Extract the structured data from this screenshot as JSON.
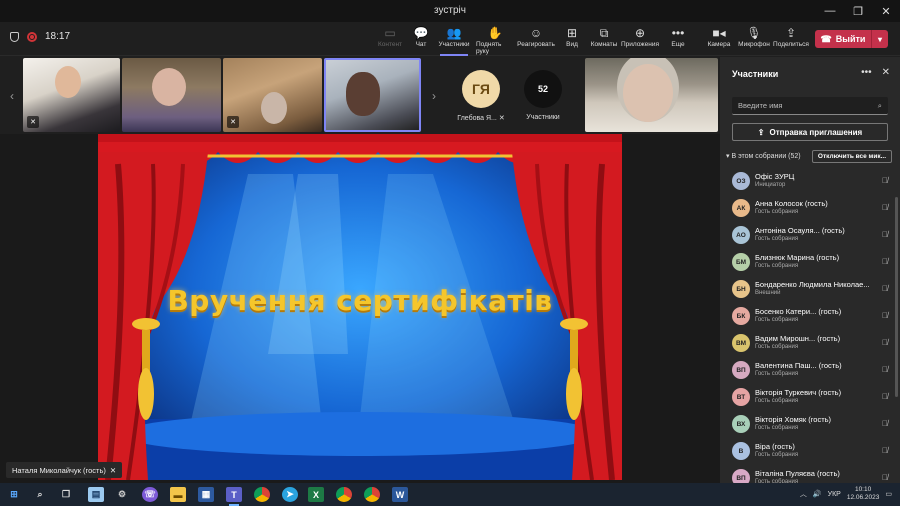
{
  "window": {
    "title": "зустріч"
  },
  "toolbar": {
    "timer": "18:17",
    "buttons": {
      "content": "Контент",
      "chat": "Чат",
      "participants": "Участники",
      "raise_hand": "Поднять руку",
      "react": "Реагировать",
      "view": "Вид",
      "rooms": "Комнаты",
      "apps": "Приложения",
      "more": "Еще",
      "camera": "Камера",
      "mic": "Микрофон",
      "share": "Поделиться"
    },
    "leave_label": "Выйти"
  },
  "strip": {
    "avatar_tile": {
      "initials": "ГЯ",
      "label": "Глебова Я..."
    },
    "count_tile": {
      "count": "52",
      "label": "Участники"
    }
  },
  "stage": {
    "slide_title": "Вручення сертифікатів",
    "presenter": "Наталя Миколайчук (гость)"
  },
  "panel": {
    "title": "Участники",
    "search_placeholder": "Введите имя",
    "invite_label": "Отправка приглашения",
    "section_label": "В этом собрании (52)",
    "mute_all_label": "Отключить все мик...",
    "participants": [
      {
        "initials": "ОЗ",
        "name": "Офіс ЗУРЦ",
        "role": "Инициатор",
        "color": "#a9b9d6"
      },
      {
        "initials": "АК",
        "name": "Анна Колосок (гость)",
        "role": "Гость собрания",
        "color": "#e8b98a"
      },
      {
        "initials": "АО",
        "name": "Антоніна Осауля... (гость)",
        "role": "Гость собрания",
        "color": "#a9c4d6"
      },
      {
        "initials": "БМ",
        "name": "Близнюк Марина (гость)",
        "role": "Гость собрания",
        "color": "#b5cfa8"
      },
      {
        "initials": "БН",
        "name": "Бондаренко Людмила Николае...",
        "role": "Внешний",
        "color": "#e7c48a"
      },
      {
        "initials": "БК",
        "name": "Босенко Катери... (гость)",
        "role": "Гость собрания",
        "color": "#e5a9a0"
      },
      {
        "initials": "ВМ",
        "name": "Вадим Мирошн... (гость)",
        "role": "Гость собрания",
        "color": "#d9c46d"
      },
      {
        "initials": "ВП",
        "name": "Валентина Паш... (гость)",
        "role": "Гость собрания",
        "color": "#d6a9c0"
      },
      {
        "initials": "ВТ",
        "name": "Вікторія Туркевич (гость)",
        "role": "Гость собрания",
        "color": "#e5a3a3"
      },
      {
        "initials": "ВХ",
        "name": "Вікторія Хомяк (гость)",
        "role": "Гость собрания",
        "color": "#a8cfb8"
      },
      {
        "initials": "В",
        "name": "Віра (гость)",
        "role": "Гость собрания",
        "color": "#a9c0e0"
      },
      {
        "initials": "ВП",
        "name": "Віталіна Пуляєва (гость)",
        "role": "Гость собрания",
        "color": "#d9a9c6"
      }
    ]
  },
  "taskbar": {
    "lang": "УКР",
    "time": "10:10",
    "date": "12.06.2023"
  }
}
